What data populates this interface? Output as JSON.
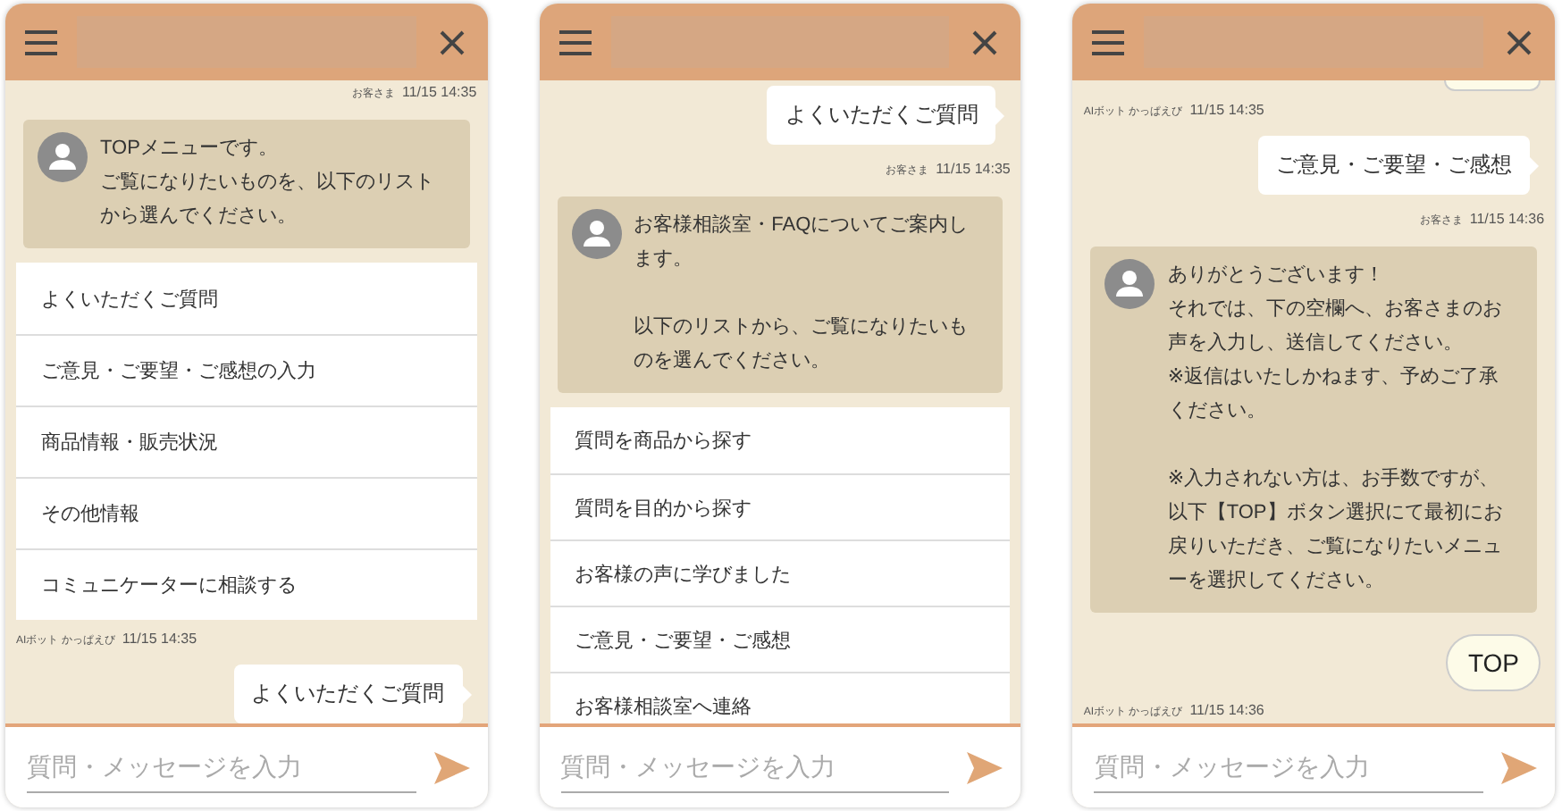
{
  "screens": [
    {
      "messages": [
        {
          "kind": "meta_user",
          "label": "お客さま",
          "time": "11/15 14:35"
        },
        {
          "kind": "bot",
          "paragraphs": [
            [
              "TOPメニューです。",
              "ご覧になりたいものを、以下のリスト",
              "から選んでください。"
            ]
          ]
        },
        {
          "kind": "menu",
          "items": [
            "よくいただくご質問",
            "ご意見・ご要望・ご感想の入力",
            "商品情報・販売状況",
            "その他情報",
            "コミュニケーターに相談する"
          ]
        },
        {
          "kind": "meta_bot",
          "label": "AIボット かっぱえび",
          "time": "11/15 14:35"
        },
        {
          "kind": "user",
          "text": "よくいただくご質問"
        }
      ],
      "input": {
        "placeholder": "質問・メッセージを入力"
      }
    },
    {
      "messages": [
        {
          "kind": "user",
          "text": "よくいただくご質問"
        },
        {
          "kind": "meta_user",
          "label": "お客さま",
          "time": "11/15 14:35"
        },
        {
          "kind": "bot",
          "paragraphs": [
            [
              "お客様相談室・FAQについてご案内し",
              "ます。"
            ],
            [
              "以下のリストから、ご覧になりたいも",
              "のを選んでください。"
            ]
          ]
        },
        {
          "kind": "menu",
          "items": [
            "質問を商品から探す",
            "質問を目的から探す",
            "お客様の声に学びました",
            "ご意見・ご要望・ご感想",
            "お客様相談室へ連絡"
          ]
        }
      ],
      "input": {
        "placeholder": "質問・メッセージを入力"
      }
    },
    {
      "messages": [
        {
          "kind": "stub"
        },
        {
          "kind": "meta_bot",
          "label": "AIボット かっぱえび",
          "time": "11/15 14:35"
        },
        {
          "kind": "user",
          "text": "ご意見・ご要望・ご感想"
        },
        {
          "kind": "meta_user",
          "label": "お客さま",
          "time": "11/15 14:36"
        },
        {
          "kind": "bot",
          "paragraphs": [
            [
              "ありがとうございます！",
              "それでは、下の空欄へ、お客さまのお",
              "声を入力し、送信してください。",
              "※返信はいたしかねます、予めご了承",
              "ください。"
            ],
            [
              "※入力されない方は、お手数ですが、",
              "以下【TOP】ボタン選択にて最初にお",
              "戻りいただき、ご覧になりたいメニュ",
              "ーを選択してください。"
            ]
          ]
        },
        {
          "kind": "chip",
          "text": "TOP"
        },
        {
          "kind": "meta_bot",
          "label": "AIボット かっぱえび",
          "time": "11/15 14:36"
        }
      ],
      "input": {
        "placeholder": "質問・メッセージを入力"
      }
    }
  ]
}
